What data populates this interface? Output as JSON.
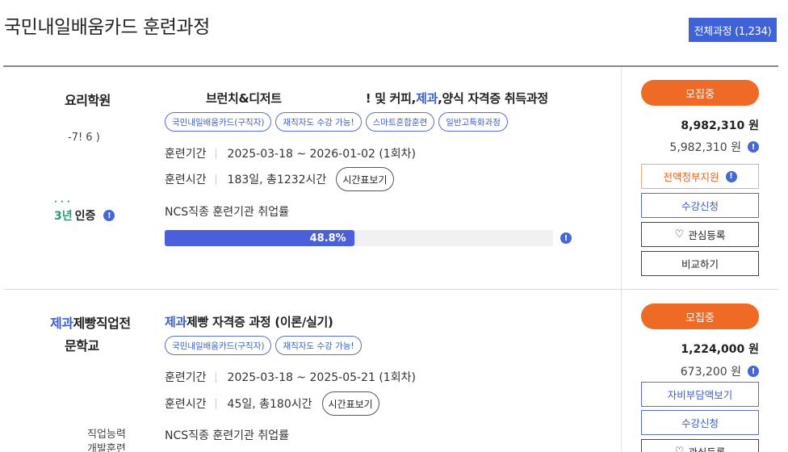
{
  "header": {
    "title": "국민내일배움카드 훈련과정",
    "total_badge": "전체과정 (1,234)"
  },
  "courses": [
    {
      "institution": {
        "name": "요리학원",
        "phone": "-7!          6 )"
      },
      "cert": {
        "years": "3년",
        "label": "인증"
      },
      "title": {
        "part1": "브런치&디저트",
        "part2": "! 및 커피,",
        "hl": "제과",
        "part3": ",양식 자격증 취득과정"
      },
      "tags": [
        "국민내일배움카드(구직자)",
        "재직자도 수강 가능!",
        "스마트혼합훈련",
        "일반고특화과정"
      ],
      "period": {
        "label": "훈련기간",
        "value": "2025-03-18 ~ 2026-01-02 (1회차)"
      },
      "hours": {
        "label": "훈련시간",
        "value": "183일, 총1232시간",
        "button": "시간표보기"
      },
      "ncs": "NCS직종 훈련기관 취업률",
      "employment_rate": {
        "text": "48.8%",
        "value": 48.8
      },
      "status": "모집중",
      "price": "8,982,310 원",
      "subsidy_price": "5,982,310 원",
      "buttons": {
        "support": "전액정부지원",
        "apply": "수강신청",
        "wishlist": "관심등록",
        "compare": "비교하기"
      }
    },
    {
      "institution": {
        "name_hl": "제과",
        "name_rest": "제빵직업전",
        "name_line2": "문학교",
        "extra": "직업능력",
        "extra2": "개발훈련"
      },
      "title": {
        "hl": "제과",
        "rest": "제빵 자격증 과정 (이론/실기)"
      },
      "tags": [
        "국민내일배움카드(구직자)",
        "재직자도 수강 가능!"
      ],
      "period": {
        "label": "훈련기간",
        "value": "2025-03-18 ~ 2025-05-21 (1회차)"
      },
      "hours": {
        "label": "훈련시간",
        "value": "45일, 총180시간",
        "button": "시간표보기"
      },
      "ncs": "NCS직종 훈련기관 취업률",
      "status": "모집중",
      "price": "1,224,000 원",
      "subsidy_price": "673,200 원",
      "buttons": {
        "self_pay": "자비부담액보기",
        "apply": "수강신청",
        "wishlist": "관심등록"
      }
    }
  ],
  "colors": {
    "accent": "#3f62d9",
    "recruit": "#ef6a25",
    "bar": "#4a5fdb"
  },
  "icons": {
    "info": "info-circle-icon",
    "heart": "heart-outline-icon"
  }
}
